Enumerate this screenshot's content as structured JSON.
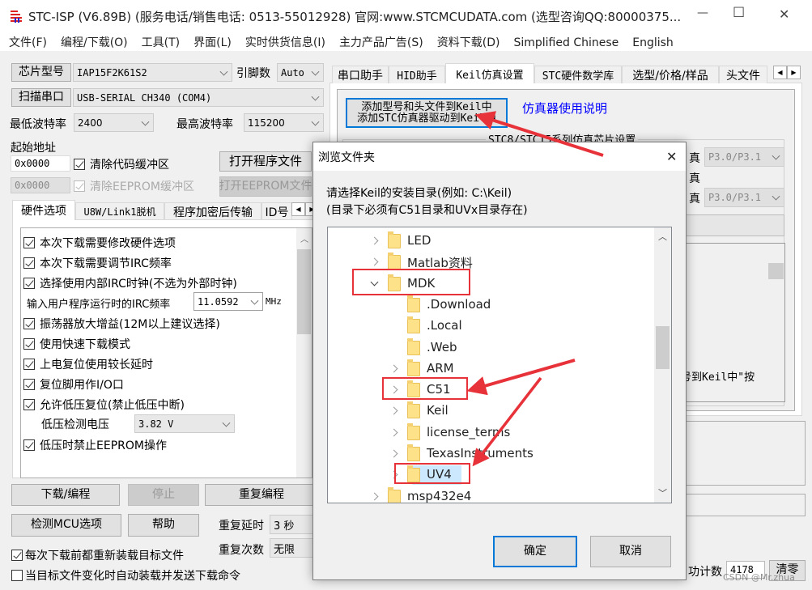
{
  "window": {
    "title": "STC-ISP (V6.89B) (服务电话/销售电话: 0513-55012928) 官网:www.STCMCUDATA.com  (选型咨询QQ:80000375...",
    "minimize": "—",
    "maximize": "☐",
    "close": "✕"
  },
  "menu": [
    "文件(F)",
    "编程/下载(O)",
    "工具(T)",
    "界面(L)",
    "实时供货信息(I)",
    "主力产品广告(S)",
    "资料下载(D)",
    "Simplified Chinese",
    "English"
  ],
  "left": {
    "chip_button": "芯片型号",
    "chip_value": "IAP15F2K61S2",
    "pins_label": "引脚数",
    "pins_value": "Auto",
    "scan_button": "扫描串口",
    "port_value": "USB-SERIAL CH340 (COM4)",
    "min_baud_label": "最低波特率",
    "min_baud": "2400",
    "max_baud_label": "最高波特率",
    "max_baud": "115200",
    "start_addr_label": "起始地址",
    "code_addr": "0x0000",
    "eeprom_addr": "0x0000",
    "clear_code": "清除代码缓冲区",
    "clear_eeprom": "清除EEPROM缓冲区",
    "open_program": "打开程序文件",
    "open_eeprom": "打开EEPROM文件",
    "tabs": [
      "硬件选项",
      "U8W/Link1脱机",
      "程序加密后传输",
      "ID号"
    ],
    "options": [
      {
        "label": "本次下载需要修改硬件选项",
        "checked": true
      },
      {
        "label": "本次下载需要调节IRC频率",
        "checked": true
      },
      {
        "label": "选择使用内部IRC时钟(不选为外部时钟)",
        "checked": true
      }
    ],
    "irc_label": "输入用户程序运行时的IRC频率",
    "irc_value": "11.0592",
    "irc_unit": "MHz",
    "options2": [
      {
        "label": "振荡器放大增益(12M以上建议选择)",
        "checked": true
      },
      {
        "label": "使用快速下载模式",
        "checked": true
      },
      {
        "label": "上电复位使用较长延时",
        "checked": true
      },
      {
        "label": "复位脚用作I/O口",
        "checked": true
      },
      {
        "label": "允许低压复位(禁止低压中断)",
        "checked": true
      }
    ],
    "lvd_label": "低压检测电压",
    "lvd_value": "3.82 V",
    "eeprom_lv": {
      "label": "低压时禁止EEPROM操作",
      "checked": true
    },
    "download": "下载/编程",
    "stop": "停止",
    "repeat": "重复编程",
    "detect": "检测MCU选项",
    "help": "帮助",
    "repeat_delay_label": "重复延时",
    "repeat_delay": "3 秒",
    "repeat_count_label": "重复次数",
    "repeat_count": "无限",
    "reload": {
      "label": "每次下载前都重新装载目标文件",
      "checked": true
    },
    "auto_load": {
      "label": "当目标文件变化时自动装载并发送下载命令",
      "checked": false
    }
  },
  "right": {
    "tabs": [
      "串口助手",
      "HID助手",
      "Keil仿真设置",
      "STC硬件数学库",
      "选型/价格/样品",
      "头文件"
    ],
    "active_tab": "Keil仿真设置",
    "add_button_line1": "添加型号和头文件到Keil中",
    "add_button_line2": "添加STC仿真器驱动到Keil中",
    "manual_link": "仿真器使用说明",
    "group_title": "STC8/STC15系列仿真芯片设置",
    "sim1_suffix": "真",
    "sim1_value": "P3.0/P3.1",
    "sim2_suffix": "真",
    "sim3_suffix": "真",
    "sim3_value": "P3.0/P3.1",
    "note_fragment": "号到Keil中\"按",
    "count_label": "功计数",
    "count_value": "4178",
    "clear": "清零"
  },
  "dialog": {
    "title": "浏览文件夹",
    "close": "✕",
    "prompt_line1": "请选择Keil的安装目录(例如: C:\\Keil)",
    "prompt_line2": "(目录下必须有C51目录和UVx目录存在)",
    "tree": [
      {
        "name": "LED",
        "level": 1,
        "expander": "collapsed"
      },
      {
        "name": "Matlab资料",
        "level": 1,
        "expander": "collapsed"
      },
      {
        "name": "MDK",
        "level": 1,
        "expander": "expanded"
      },
      {
        "name": ".Download",
        "level": 2,
        "expander": "none"
      },
      {
        "name": ".Local",
        "level": 2,
        "expander": "none"
      },
      {
        "name": ".Web",
        "level": 2,
        "expander": "none"
      },
      {
        "name": "ARM",
        "level": 2,
        "expander": "collapsed"
      },
      {
        "name": "C51",
        "level": 2,
        "expander": "collapsed"
      },
      {
        "name": "Keil",
        "level": 2,
        "expander": "collapsed"
      },
      {
        "name": "license_terms",
        "level": 2,
        "expander": "collapsed"
      },
      {
        "name": "TexasInstruments",
        "level": 2,
        "expander": "collapsed"
      },
      {
        "name": "UV4",
        "level": 2,
        "expander": "collapsed",
        "selected": true
      },
      {
        "name": "msp432e4",
        "level": 1,
        "expander": "collapsed"
      }
    ],
    "ok": "确定",
    "cancel": "取消"
  },
  "watermark": "CSDN @Mr.zhua",
  "colors": {
    "annotation": "#e8323a",
    "link": "#0000ff",
    "selection": "#cce8ff",
    "focus": "#0078d7"
  }
}
